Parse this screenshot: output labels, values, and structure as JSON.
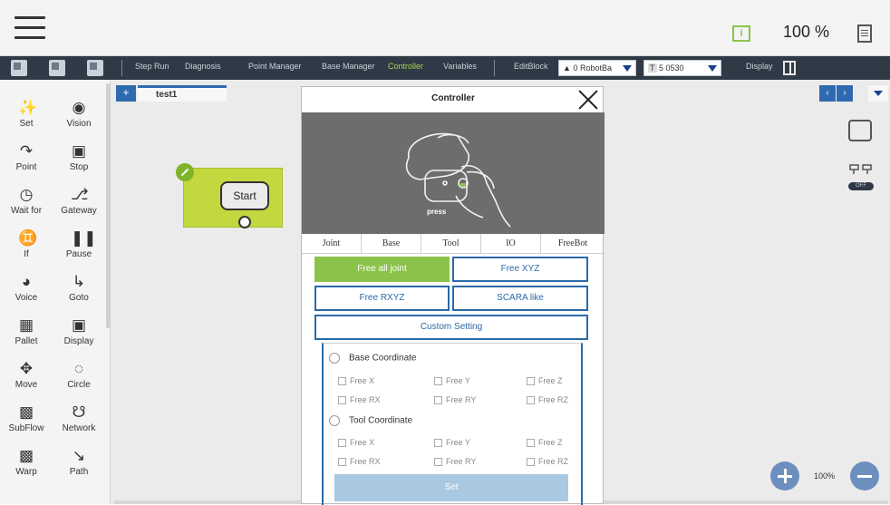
{
  "header": {
    "speed": "100 %"
  },
  "toolbar": {
    "items": [
      "Step Run",
      "Diagnosis",
      "Point Manager",
      "Base Manager",
      "Controller",
      "Variables",
      "EditBlock",
      "Display"
    ],
    "robot_base_select": "0 RobotBa",
    "tool_select": "5 0530",
    "tool_badge": "T"
  },
  "sidebar": {
    "nodes": [
      {
        "label": "Set",
        "icon": "set-icon"
      },
      {
        "label": "Vision",
        "icon": "vision-icon"
      },
      {
        "label": "Point",
        "icon": "point-icon"
      },
      {
        "label": "Stop",
        "icon": "stop-icon"
      },
      {
        "label": "Wait for",
        "icon": "wait-icon"
      },
      {
        "label": "Gateway",
        "icon": "gateway-icon"
      },
      {
        "label": "If",
        "icon": "if-icon"
      },
      {
        "label": "Pause",
        "icon": "pause-icon"
      },
      {
        "label": "Voice",
        "icon": "voice-icon"
      },
      {
        "label": "Goto",
        "icon": "goto-icon"
      },
      {
        "label": "Pallet",
        "icon": "pallet-icon"
      },
      {
        "label": "Display",
        "icon": "display-icon"
      },
      {
        "label": "Move",
        "icon": "move-icon"
      },
      {
        "label": "Circle",
        "icon": "circle-icon"
      },
      {
        "label": "SubFlow",
        "icon": "subflow-icon"
      },
      {
        "label": "Network",
        "icon": "network-icon"
      },
      {
        "label": "Warp",
        "icon": "warp-icon"
      },
      {
        "label": "Path",
        "icon": "path-icon"
      }
    ]
  },
  "canvas": {
    "tab_plus": "+",
    "tab_name": "test1",
    "start_label": "Start",
    "zoom": "100%",
    "off_label": "OFF"
  },
  "modal": {
    "title": "Controller",
    "press_label": "press",
    "tabs": [
      "Joint",
      "Base",
      "Tool",
      "IO",
      "FreeBot"
    ],
    "buttons": {
      "free_all_joint": "Free all joint",
      "free_xyz": "Free XYZ",
      "free_rxyz": "Free RXYZ",
      "scara_like": "SCARA like",
      "custom_setting": "Custom Setting"
    },
    "base_coordinate": {
      "label": "Base Coordinate",
      "options": [
        "Free X",
        "Free Y",
        "Free Z",
        "Free RX",
        "Free RY",
        "Free RZ"
      ]
    },
    "tool_coordinate": {
      "label": "Tool Coordinate",
      "options": [
        "Free X",
        "Free Y",
        "Free Z",
        "Free RX",
        "Free RY",
        "Free RZ"
      ]
    },
    "set_label": "Set"
  },
  "colors": {
    "accent_green": "#8bc34a",
    "accent_blue": "#2a6aa8",
    "toolbar_bg": "#2f3a46"
  }
}
